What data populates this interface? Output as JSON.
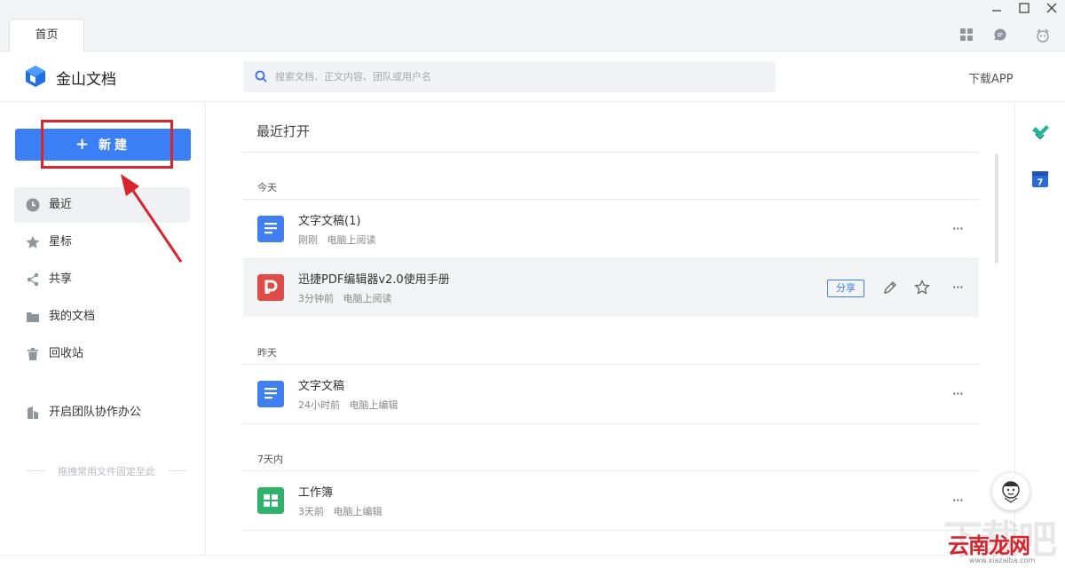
{
  "window": {
    "tab_label": "首页",
    "controls": [
      "minimize-icon",
      "maximize-icon",
      "close-icon"
    ],
    "toolbar_icons": [
      "apps-grid-icon",
      "message-icon",
      "skin-icon"
    ]
  },
  "header": {
    "app_name": "金山文档",
    "search_placeholder": "搜索文档、正文内容、团队或用户名",
    "download_label": "下载APP"
  },
  "sidebar": {
    "new_button": {
      "plus": "+",
      "label": "新建"
    },
    "items": [
      {
        "label": "最近",
        "icon": "clock-icon",
        "active": true
      },
      {
        "label": "星标",
        "icon": "star-icon"
      },
      {
        "label": "共享",
        "icon": "share-icon"
      },
      {
        "label": "我的文档",
        "icon": "folder-icon"
      },
      {
        "label": "回收站",
        "icon": "trash-icon"
      },
      {
        "label": "开启团队协作办公",
        "icon": "building-icon"
      }
    ],
    "drop_hint": "拖拽常用文件固定至此"
  },
  "main": {
    "title": "最近打开",
    "groups": [
      {
        "label": "今天"
      },
      {
        "label": "昨天"
      },
      {
        "label": "7天内"
      }
    ],
    "files": [
      {
        "name": "文字文稿(1)",
        "time": "刚刚",
        "action": "电脑上阅读",
        "type": "doc"
      },
      {
        "name": "迅捷PDF编辑器v2.0使用手册",
        "time": "3分钟前",
        "action": "电脑上阅读",
        "type": "pdf",
        "share_label": "分享"
      },
      {
        "name": "文字文稿",
        "time": "24小时前",
        "action": "电脑上编辑",
        "type": "doc"
      },
      {
        "name": "工作簿",
        "time": "3天前",
        "action": "电脑上编辑",
        "type": "sheet"
      }
    ],
    "more_label": "···"
  },
  "rightbar": {
    "icons": [
      "check-icon",
      "calendar-icon"
    ],
    "calendar_day": "7"
  },
  "watermark": {
    "text": "云南龙网",
    "url": "www.xiazaiba.com",
    "faint": "下载吧"
  },
  "colors": {
    "accent": "#3b7ff5",
    "annotation": "#d9242b",
    "doc": "#3f7ef3",
    "pdf": "#e04b48",
    "sheet": "#2fb36a"
  }
}
